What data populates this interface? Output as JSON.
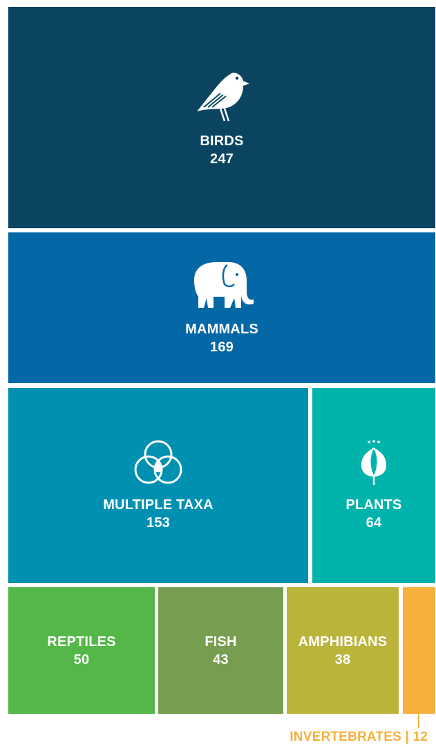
{
  "chart_data": {
    "type": "treemap",
    "title": "",
    "items": [
      {
        "label": "BIRDS",
        "value": 247,
        "color": "#0a4460",
        "icon": "bird-icon"
      },
      {
        "label": "MAMMALS",
        "value": 169,
        "color": "#0568a6",
        "icon": "elephant-icon"
      },
      {
        "label": "MULTIPLE TAXA",
        "value": 153,
        "color": "#0090b1",
        "icon": "overlapping-circles-icon"
      },
      {
        "label": "PLANTS",
        "value": 64,
        "color": "#00b4ac",
        "icon": "flower-bud-icon"
      },
      {
        "label": "REPTILES",
        "value": 50,
        "color": "#53b848",
        "icon": ""
      },
      {
        "label": "FISH",
        "value": 43,
        "color": "#779e50",
        "icon": ""
      },
      {
        "label": "AMPHIBIANS",
        "value": 38,
        "color": "#bbb43b",
        "icon": ""
      },
      {
        "label": "INVERTEBRATES",
        "value": 12,
        "color": "#f6b13d",
        "icon": ""
      }
    ],
    "callout": "INVERTEBRATES | 12"
  }
}
